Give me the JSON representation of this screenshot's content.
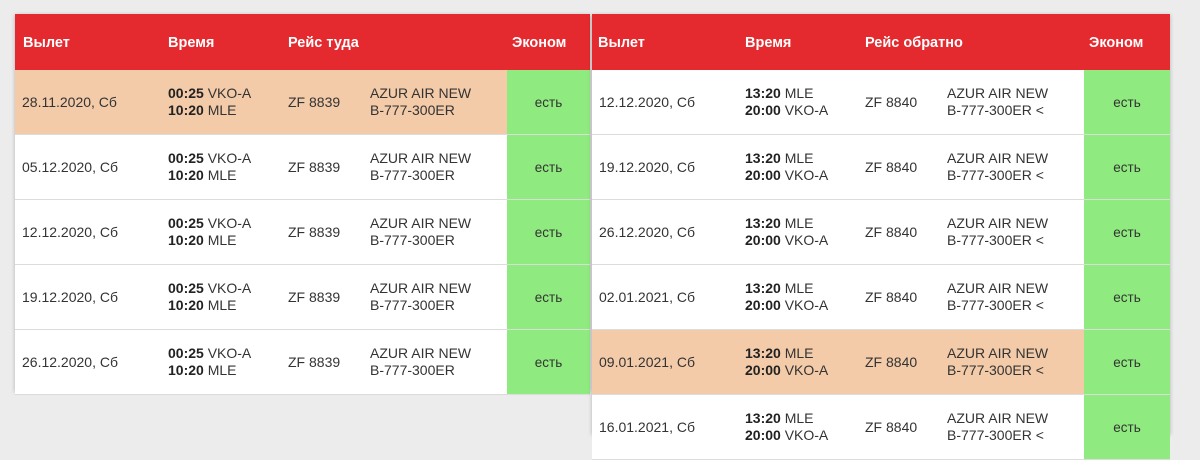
{
  "outbound": {
    "headers": {
      "departure": "Вылет",
      "time": "Время",
      "flight": "Рейс туда",
      "economy": "Эконом"
    },
    "rows": [
      {
        "date": "28.11.2020, Сб",
        "t1": "00:25",
        "a1": "VKO-A",
        "t2": "10:20",
        "a2": "MLE",
        "flight": "ZF 8839",
        "aircraft1": "AZUR AIR NEW",
        "aircraft2": "B-777-300ER",
        "economy": "есть",
        "highlight": true
      },
      {
        "date": "05.12.2020, Сб",
        "t1": "00:25",
        "a1": "VKO-A",
        "t2": "10:20",
        "a2": "MLE",
        "flight": "ZF 8839",
        "aircraft1": "AZUR AIR NEW",
        "aircraft2": "B-777-300ER",
        "economy": "есть",
        "highlight": false
      },
      {
        "date": "12.12.2020, Сб",
        "t1": "00:25",
        "a1": "VKO-A",
        "t2": "10:20",
        "a2": "MLE",
        "flight": "ZF 8839",
        "aircraft1": "AZUR AIR NEW",
        "aircraft2": "B-777-300ER",
        "economy": "есть",
        "highlight": false
      },
      {
        "date": "19.12.2020, Сб",
        "t1": "00:25",
        "a1": "VKO-A",
        "t2": "10:20",
        "a2": "MLE",
        "flight": "ZF 8839",
        "aircraft1": "AZUR AIR NEW",
        "aircraft2": "B-777-300ER",
        "economy": "есть",
        "highlight": false
      },
      {
        "date": "26.12.2020, Сб",
        "t1": "00:25",
        "a1": "VKO-A",
        "t2": "10:20",
        "a2": "MLE",
        "flight": "ZF 8839",
        "aircraft1": "AZUR AIR NEW",
        "aircraft2": "B-777-300ER",
        "economy": "есть",
        "highlight": false
      }
    ]
  },
  "return": {
    "headers": {
      "departure": "Вылет",
      "time": "Время",
      "flight": "Рейс обратно",
      "economy": "Эконом"
    },
    "rows": [
      {
        "date": "12.12.2020, Сб",
        "t1": "13:20",
        "a1": "MLE",
        "t2": "20:00",
        "a2": "VKO-A",
        "flight": "ZF 8840",
        "aircraft1": "AZUR AIR NEW",
        "aircraft2": "B-777-300ER <",
        "economy": "есть",
        "highlight": false
      },
      {
        "date": "19.12.2020, Сб",
        "t1": "13:20",
        "a1": "MLE",
        "t2": "20:00",
        "a2": "VKO-A",
        "flight": "ZF 8840",
        "aircraft1": "AZUR AIR NEW",
        "aircraft2": "B-777-300ER <",
        "economy": "есть",
        "highlight": false
      },
      {
        "date": "26.12.2020, Сб",
        "t1": "13:20",
        "a1": "MLE",
        "t2": "20:00",
        "a2": "VKO-A",
        "flight": "ZF 8840",
        "aircraft1": "AZUR AIR NEW",
        "aircraft2": "B-777-300ER <",
        "economy": "есть",
        "highlight": false
      },
      {
        "date": "02.01.2021, Сб",
        "t1": "13:20",
        "a1": "MLE",
        "t2": "20:00",
        "a2": "VKO-A",
        "flight": "ZF 8840",
        "aircraft1": "AZUR AIR NEW",
        "aircraft2": "B-777-300ER <",
        "economy": "есть",
        "highlight": false
      },
      {
        "date": "09.01.2021, Сб",
        "t1": "13:20",
        "a1": "MLE",
        "t2": "20:00",
        "a2": "VKO-A",
        "flight": "ZF 8840",
        "aircraft1": "AZUR AIR NEW",
        "aircraft2": "B-777-300ER <",
        "economy": "есть",
        "highlight": true
      },
      {
        "date": "16.01.2021, Сб",
        "t1": "13:20",
        "a1": "MLE",
        "t2": "20:00",
        "a2": "VKO-A",
        "flight": "ZF 8840",
        "aircraft1": "AZUR AIR NEW",
        "aircraft2": "B-777-300ER <",
        "economy": "есть",
        "highlight": false
      }
    ]
  },
  "colors": {
    "header": "#e42a2f",
    "highlight_row": "#f3cba9",
    "available": "#8fea7f"
  }
}
